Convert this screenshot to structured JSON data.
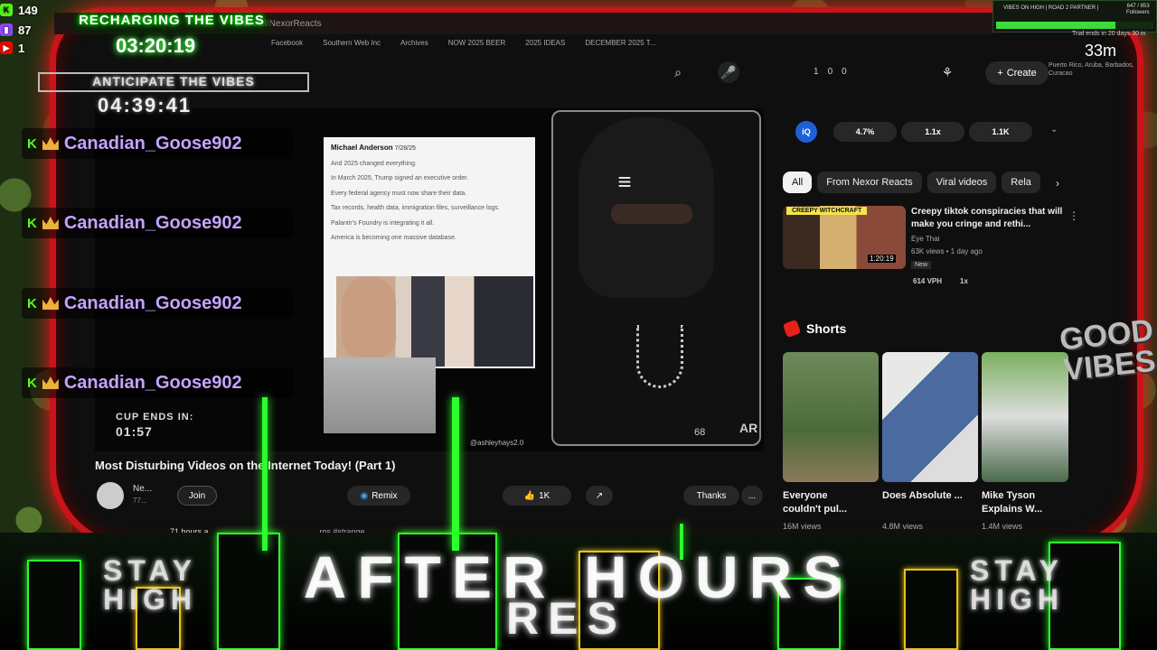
{
  "overlay": {
    "kick_count": "149",
    "twitch_count": "87",
    "youtube_count": "1",
    "charging_title": "RECHARGING THE VIBES",
    "charging_time": "03:20:19",
    "anticipate_title": "ANTICIPATE THE VIBES",
    "anticipate_time": "04:39:41",
    "chat_users": [
      "Canadian_Goose902",
      "Canadian_Goose902",
      "Canadian_Goose902",
      "Canadian_Goose902"
    ],
    "cup_label": "CUP ENDS IN:",
    "cup_time": "01:57",
    "road_title": "VIBES ON HIGH | ROAD 2 PARTNER |",
    "road_count": "647 / 853",
    "road_unit": "Followers",
    "road_progress": 0.759,
    "timer_value": "33m",
    "timer_label": "Trial ends in 20 days 30 in",
    "location_text": "Puerto Rico, Aruba, Barbados, Curacao",
    "good_vibes": "GOOD VIBES",
    "after_hours_1": "AFTER HOURS",
    "after_hours_2": "RES",
    "stay_high_left": "STAY HIGH",
    "stay_high_right": "STAY HIGH",
    "colors": {
      "kick": "#53fc18",
      "twitch": "#9146ff",
      "youtube": "#ff0000",
      "neon": "#2dff2d",
      "frame": "#c8141a"
    }
  },
  "browser": {
    "address": "channel/NexorReacts",
    "bookmarks": [
      "Facebook",
      "Southern Web Inc",
      "Archives",
      "NOW 2025 BEER",
      "2025 IDEAS",
      "DECEMBER 2025 T..."
    ],
    "search_icon": "search-icon",
    "mic_icon": "mic-icon",
    "create_label": "Create",
    "ext_counts": [
      "1",
      "0",
      "0"
    ]
  },
  "video": {
    "tweet_name": "Michael Anderson",
    "tweet_date": "7/28/25",
    "tweet_lines": [
      "And 2025 changed everything.",
      "In March 2025, Trump signed an executive order.",
      "Every federal agency must now share their data.",
      "Tax records, health data, immigration files, surveillance logs.",
      "Palantir's Foundry is integrating it all.",
      "America is becoming one massive database."
    ],
    "credit": "@ashleyhays2.0",
    "hood_num": "68",
    "hood_tag": "AR",
    "title": "Most Disturbing Videos on the Internet Today! (Part 1)",
    "channel_name": "Ne...",
    "channel_subs": "77...",
    "join_label": "Join",
    "remix_label": "Remix",
    "like_count": "1K",
    "thanks_label": "Thanks",
    "more_label": "...",
    "views_line": "71 hours a...",
    "hashtag": "...ros #strange"
  },
  "sidebar": {
    "stats": [
      "4.7%",
      "1.1x",
      "1.1K"
    ],
    "chips": [
      "All",
      "From Nexor Reacts",
      "Viral videos",
      "Rela"
    ],
    "rec": {
      "label": "CREEPY WITCHCRAFT",
      "duration": "1:20:19",
      "title": "Creepy tiktok conspiracies that will make you cringe and rethi...",
      "channel": "Eye Thai",
      "meta": "63K views • 1 day ago",
      "new_badge": "New",
      "vph": "614 VPH",
      "x": "1x"
    },
    "shorts_title": "Shorts",
    "shorts": [
      {
        "title": "Everyone couldn't pul...",
        "views": "16M views"
      },
      {
        "title": "Does Absolute ...",
        "views": "4.8M views"
      },
      {
        "title": "Mike Tyson Explains W...",
        "views": "1.4M views"
      }
    ]
  }
}
